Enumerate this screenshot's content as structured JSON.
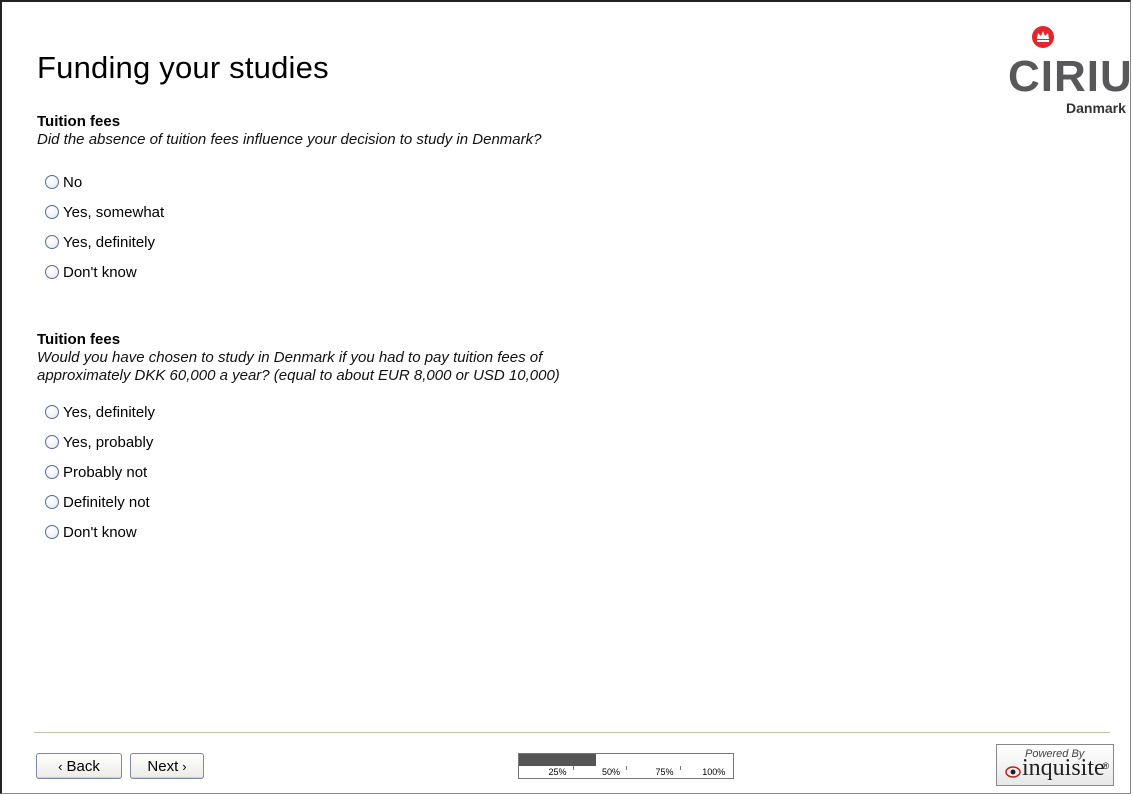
{
  "page": {
    "title": "Funding your studies"
  },
  "logo": {
    "name": "CIRIUS",
    "sub": "Danmark"
  },
  "questions": [
    {
      "heading": "Tuition fees",
      "text": "Did the absence of tuition fees influence your decision to study in Denmark?",
      "options": [
        "No",
        "Yes, somewhat",
        "Yes, definitely",
        "Don't know"
      ]
    },
    {
      "heading": "Tuition fees",
      "text_line1": "Would you have chosen to study in Denmark if you had to pay tuition fees of",
      "text_line2": "approximately DKK 60,000 a year? (equal to about EUR 8,000 or USD 10,000)",
      "options": [
        "Yes, definitely",
        "Yes, probably",
        "Probably not",
        "Definitely not",
        "Don't know"
      ]
    }
  ],
  "nav": {
    "back_label": "Back",
    "next_label": "Next"
  },
  "progress": {
    "fraction": 0.36,
    "ticks": [
      "25%",
      "50%",
      "75%",
      "100%"
    ]
  },
  "powered": {
    "by": "Powered By",
    "brand": "inquisite",
    "reg": "®"
  },
  "colors": {
    "progress_fill": "#555555",
    "radio_border": "#5b6f93",
    "logo_gray": "#58585a",
    "crown_red": "#e3262b"
  }
}
